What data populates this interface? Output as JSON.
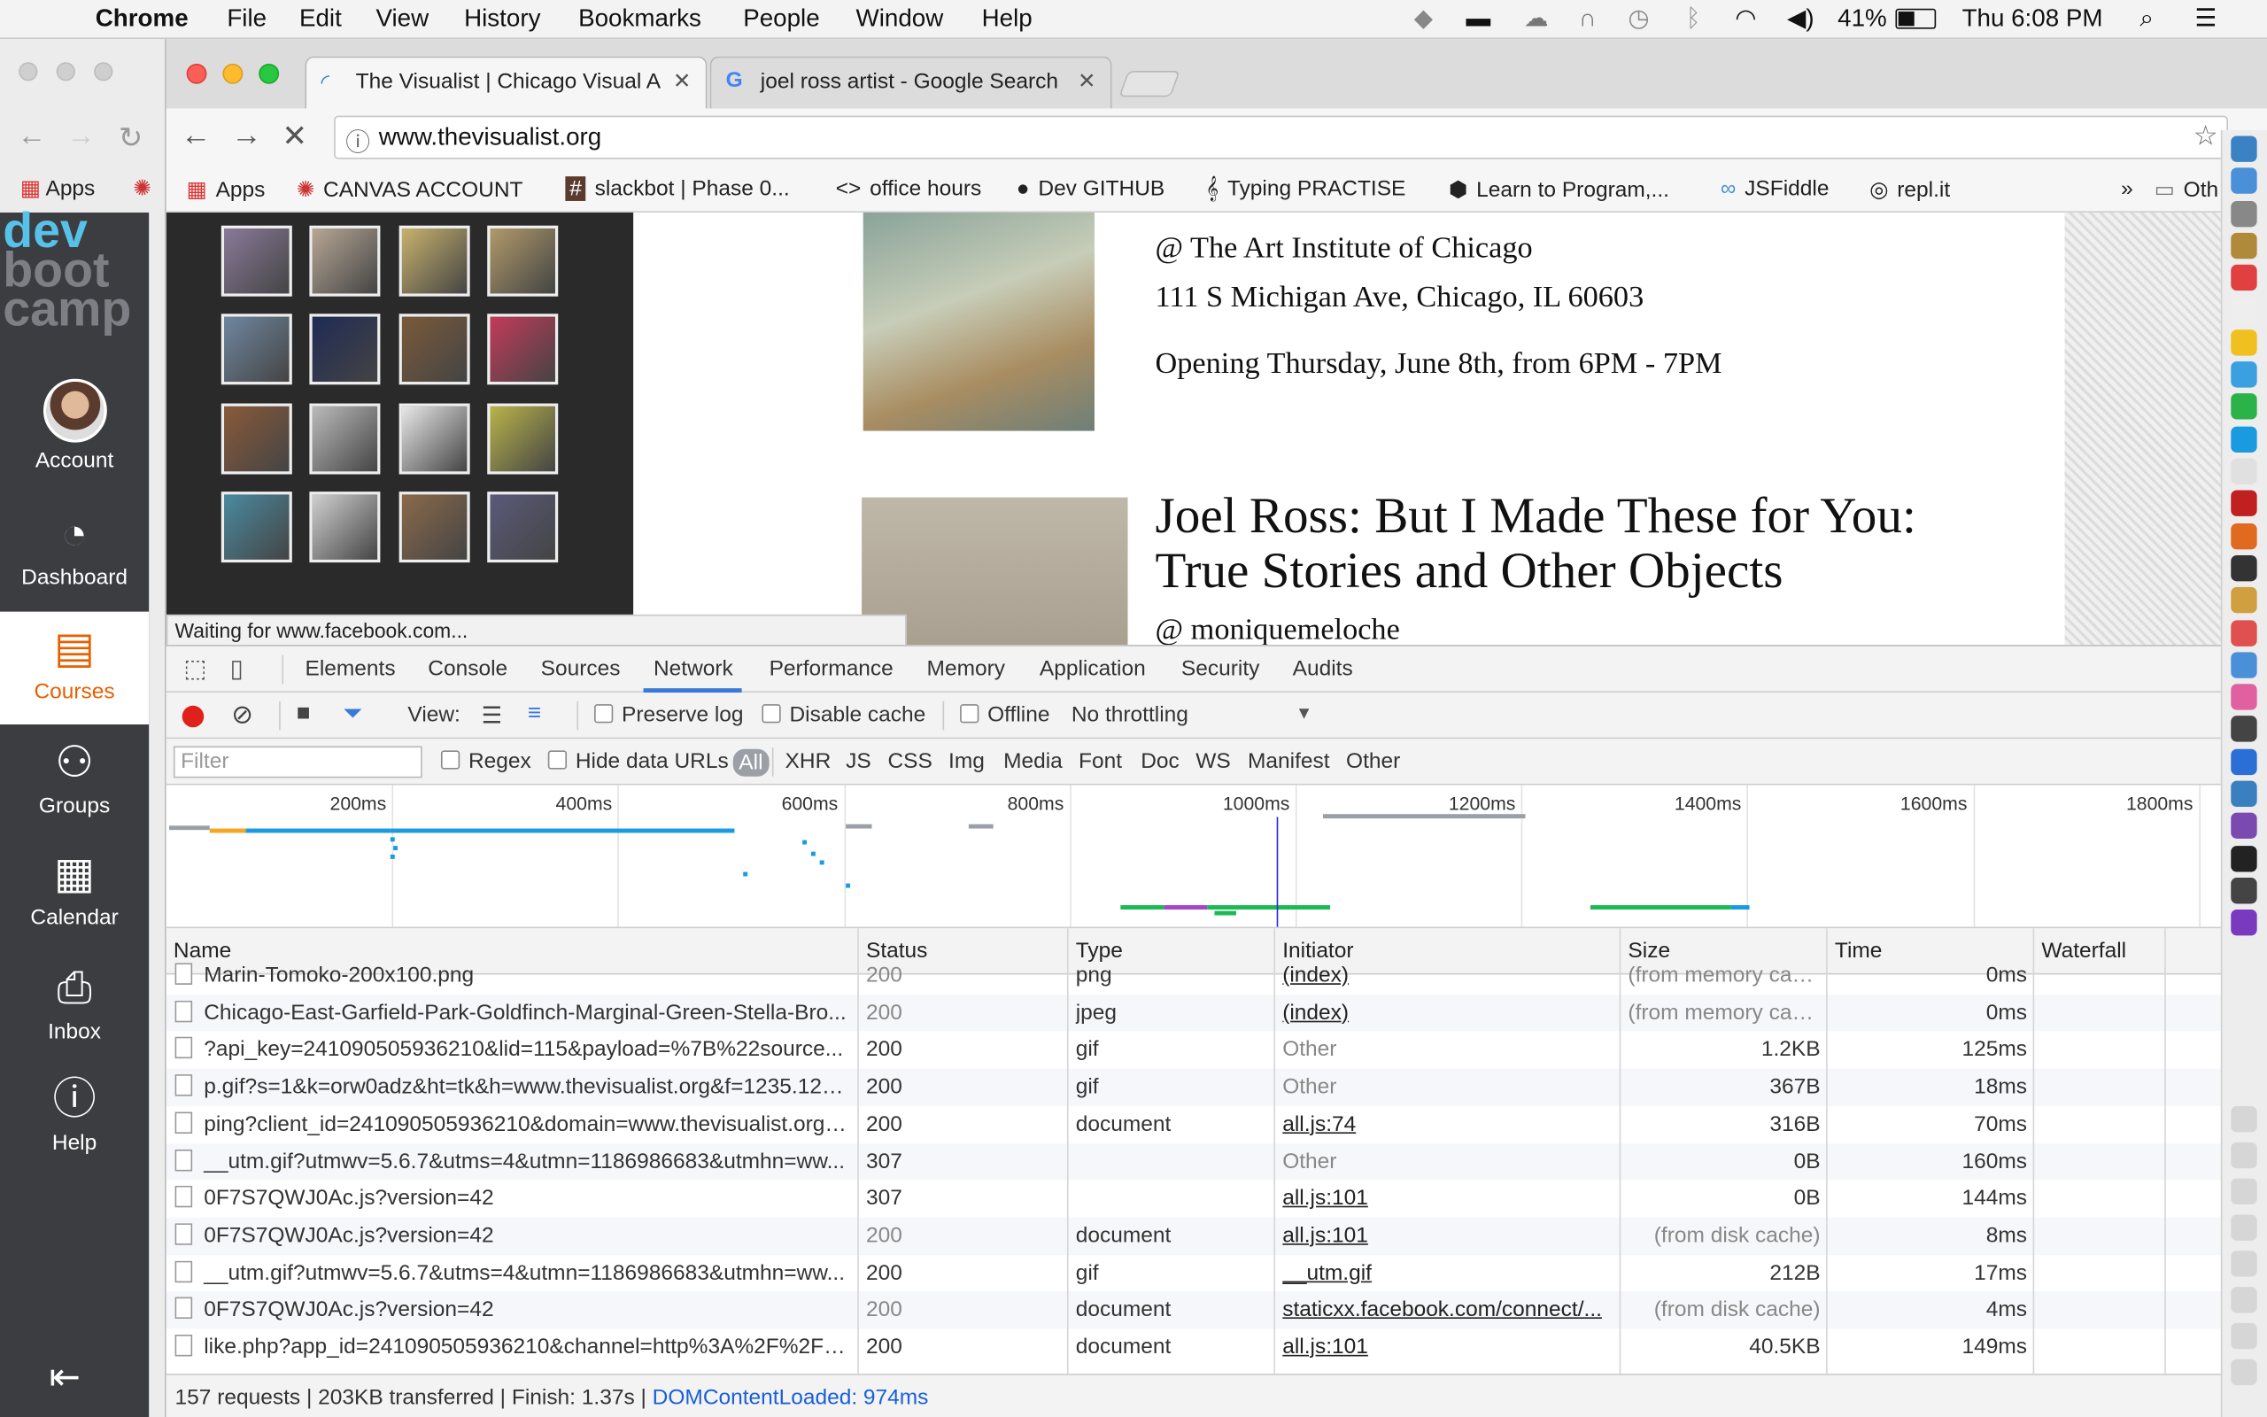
{
  "menubar": {
    "app": "Chrome",
    "items": [
      "File",
      "Edit",
      "View",
      "History",
      "Bookmarks",
      "People",
      "Window",
      "Help"
    ],
    "battery": "41%",
    "clock": "Thu 6:08 PM"
  },
  "sidebar": {
    "logo": [
      "dev",
      "boot",
      "camp"
    ],
    "items": [
      {
        "label": "Account",
        "icon": "avatar"
      },
      {
        "label": "Dashboard",
        "icon": "dashboard-icon"
      },
      {
        "label": "Courses",
        "icon": "courses-icon"
      },
      {
        "label": "Groups",
        "icon": "groups-icon"
      },
      {
        "label": "Calendar",
        "icon": "calendar-icon"
      },
      {
        "label": "Inbox",
        "icon": "inbox-icon"
      },
      {
        "label": "Help",
        "icon": "help-icon"
      }
    ],
    "active": "Courses"
  },
  "back_window": {
    "bookmark_apps": "Apps"
  },
  "tabs": [
    {
      "title": "The Visualist | Chicago Visual A",
      "active": true
    },
    {
      "title": "joel ross artist - Google Search",
      "active": false
    }
  ],
  "omnibox": {
    "url": "www.thevisualist.org"
  },
  "bookmarks": [
    {
      "label": "Apps",
      "icon": "apps-grid-icon"
    },
    {
      "label": "CANVAS ACCOUNT",
      "icon": "canvas-icon"
    },
    {
      "label": "slackbot | Phase 0...",
      "icon": "slack-icon"
    },
    {
      "label": "office hours",
      "icon": "code-icon"
    },
    {
      "label": "Dev GITHUB",
      "icon": "github-icon"
    },
    {
      "label": "Typing PRACTISE",
      "icon": "typing-icon"
    },
    {
      "label": "Learn to Program,...",
      "icon": "hexagon-icon"
    },
    {
      "label": "JSFiddle",
      "icon": "jsfiddle-icon"
    },
    {
      "label": "repl.it",
      "icon": "replit-icon"
    },
    {
      "label": "Oth",
      "icon": "folder-icon"
    }
  ],
  "page": {
    "event1": {
      "venue": "@ The Art Institute of Chicago",
      "address": "111 S Michigan Ave, Chicago, IL 60603",
      "opening": "Opening Thursday, June 8th, from 6PM - 7PM"
    },
    "event2": {
      "title_line1": "Joel Ross: But I Made These for You:",
      "title_line2": "True Stories and Other Objects",
      "venue": "@ moniquemeloche"
    },
    "status": "Waiting for www.facebook.com..."
  },
  "devtools": {
    "tabs": [
      "Elements",
      "Console",
      "Sources",
      "Network",
      "Performance",
      "Memory",
      "Application",
      "Security",
      "Audits"
    ],
    "active_tab": "Network",
    "toolbar": {
      "view": "View:",
      "preserve_log": "Preserve log",
      "disable_cache": "Disable cache",
      "offline": "Offline",
      "throttling": "No throttling"
    },
    "filter": {
      "placeholder": "Filter",
      "regex": "Regex",
      "hide_data_urls": "Hide data URLs",
      "types": [
        "All",
        "XHR",
        "JS",
        "CSS",
        "Img",
        "Media",
        "Font",
        "Doc",
        "WS",
        "Manifest",
        "Other"
      ]
    },
    "timeline_ticks": [
      "200ms",
      "400ms",
      "600ms",
      "800ms",
      "1000ms",
      "1200ms",
      "1400ms",
      "1600ms",
      "1800ms"
    ],
    "columns": [
      "Name",
      "Status",
      "Type",
      "Initiator",
      "Size",
      "Time",
      "Waterfall"
    ],
    "rows": [
      {
        "name": "Marin-Tomoko-200x100.png",
        "status": "200",
        "type": "png",
        "initiator": "(index)",
        "size": "(from memory cac...",
        "time": "0ms",
        "dim": true,
        "link": true
      },
      {
        "name": "Chicago-East-Garfield-Park-Goldfinch-Marginal-Green-Stella-Bro...",
        "status": "200",
        "type": "jpeg",
        "initiator": "(index)",
        "size": "(from memory cac...",
        "time": "0ms",
        "dim": true,
        "link": true
      },
      {
        "name": "?api_key=241090505936210&lid=115&payload=%7B%22source...",
        "status": "200",
        "type": "gif",
        "initiator": "Other",
        "size": "1.2KB",
        "time": "125ms",
        "dim": false,
        "link": false
      },
      {
        "name": "p.gif?s=1&k=orw0adz&ht=tk&h=www.thevisualist.org&f=1235.123...",
        "status": "200",
        "type": "gif",
        "initiator": "Other",
        "size": "367B",
        "time": "18ms",
        "dim": false,
        "link": false
      },
      {
        "name": "ping?client_id=241090505936210&domain=www.thevisualist.org&...",
        "status": "200",
        "type": "document",
        "initiator": "all.js:74",
        "size": "316B",
        "time": "70ms",
        "dim": false,
        "link": true
      },
      {
        "name": "__utm.gif?utmwv=5.6.7&utms=4&utmn=1186986683&utmhn=ww...",
        "status": "307",
        "type": "",
        "initiator": "Other",
        "size": "0B",
        "time": "160ms",
        "dim": false,
        "link": false
      },
      {
        "name": "0F7S7QWJ0Ac.js?version=42",
        "status": "307",
        "type": "",
        "initiator": "all.js:101",
        "size": "0B",
        "time": "144ms",
        "dim": false,
        "link": true
      },
      {
        "name": "0F7S7QWJ0Ac.js?version=42",
        "status": "200",
        "type": "document",
        "initiator": "all.js:101",
        "size": "(from disk cache)",
        "time": "8ms",
        "dim": true,
        "link": true
      },
      {
        "name": "__utm.gif?utmwv=5.6.7&utms=4&utmn=1186986683&utmhn=ww...",
        "status": "200",
        "type": "gif",
        "initiator": "__utm.gif",
        "size": "212B",
        "time": "17ms",
        "dim": false,
        "link": true
      },
      {
        "name": "0F7S7QWJ0Ac.js?version=42",
        "status": "200",
        "type": "document",
        "initiator": "staticxx.facebook.com/connect/...",
        "size": "(from disk cache)",
        "time": "4ms",
        "dim": true,
        "link": true
      },
      {
        "name": "like.php?app_id=241090505936210&channel=http%3A%2F%2Fs...",
        "status": "200",
        "type": "document",
        "initiator": "all.js:101",
        "size": "40.5KB",
        "time": "149ms",
        "dim": false,
        "link": true
      }
    ],
    "summary": "157 requests | 203KB transferred | Finish: 1.37s | ",
    "dcl": "DOMContentLoaded: 974ms"
  },
  "colors": {
    "canvas_sidebar": "#3b3d41",
    "active_accent": "#e66000",
    "devtools_blue": "#3879d9",
    "record_red": "#e0201a"
  }
}
